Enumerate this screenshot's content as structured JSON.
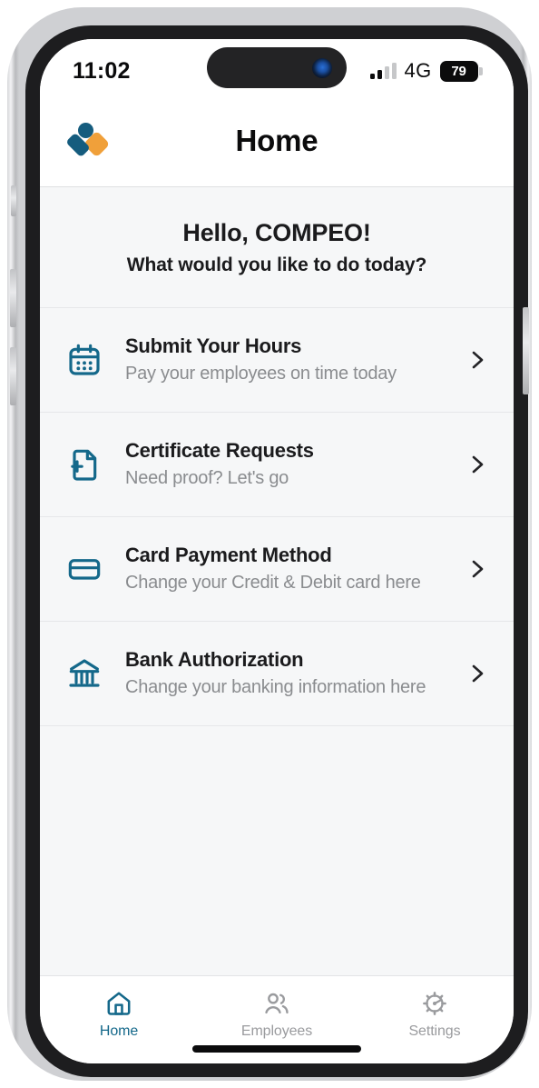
{
  "status_bar": {
    "time": "11:02",
    "network": "4G",
    "battery_percent": "79",
    "signal_icon": "cellular-bars-icon",
    "battery_icon": "battery-icon",
    "camera_icon": "front-camera-icon"
  },
  "header": {
    "title": "Home",
    "logo_icon": "app-logo-icon",
    "logo_colors": {
      "primary": "#155C7E",
      "accent": "#F0A03A"
    }
  },
  "greeting": {
    "line1": "Hello, COMPEO!",
    "line2": "What would you like to do today?"
  },
  "menu": {
    "items": [
      {
        "icon": "calendar-icon",
        "title": "Submit Your Hours",
        "subtitle": "Pay your employees on time today",
        "chevron": "chevron-right-icon"
      },
      {
        "icon": "document-add-icon",
        "title": "Certificate Requests",
        "subtitle": "Need proof? Let's go",
        "chevron": "chevron-right-icon"
      },
      {
        "icon": "credit-card-icon",
        "title": "Card Payment Method",
        "subtitle": "Change your Credit & Debit card here",
        "chevron": "chevron-right-icon"
      },
      {
        "icon": "bank-icon",
        "title": "Bank Authorization",
        "subtitle": "Change your banking information here",
        "chevron": "chevron-right-icon"
      }
    ]
  },
  "tab_bar": {
    "items": [
      {
        "label": "Home",
        "icon": "home-icon",
        "active": true
      },
      {
        "label": "Employees",
        "icon": "people-icon",
        "active": false
      },
      {
        "label": "Settings",
        "icon": "gear-icon",
        "active": false
      }
    ]
  },
  "colors": {
    "accent_teal": "#14688A",
    "icon_teal": "#14688A",
    "inactive_gray": "#9A9B9E",
    "screen_bg": "#F6F7F8",
    "surface": "#FFFFFF"
  }
}
